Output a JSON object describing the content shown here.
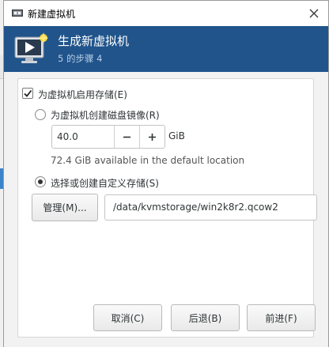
{
  "window": {
    "title": "新建虚拟机"
  },
  "banner": {
    "heading": "生成新虚拟机",
    "step": "5 的步骤 4"
  },
  "storage": {
    "enable_label": "为虚拟机启用存储(E)",
    "enable_checked": true,
    "create_disk_label": "为虚拟机创建磁盘镜像(R)",
    "create_disk_selected": false,
    "size_value": "40.0",
    "size_unit": "GiB",
    "available_text": "72.4 GiB available in the default location",
    "custom_label": "选择或创建自定义存储(S)",
    "custom_selected": true,
    "manage_button": "管理(M)...",
    "path_value": "/data/kvmstorage/win2k8r2.qcow2"
  },
  "footer": {
    "cancel": "取消(C)",
    "back": "后退(B)",
    "forward": "前进(F)"
  },
  "colors": {
    "banner_bg": "#20548b",
    "dialog_bg": "#f2f2f2"
  },
  "icons": {
    "app": "virt-manager-icon",
    "close": "close-icon",
    "banner": "monitor-new-vm-icon",
    "check": "check-icon",
    "minus": "minus-icon",
    "plus": "plus-icon"
  }
}
